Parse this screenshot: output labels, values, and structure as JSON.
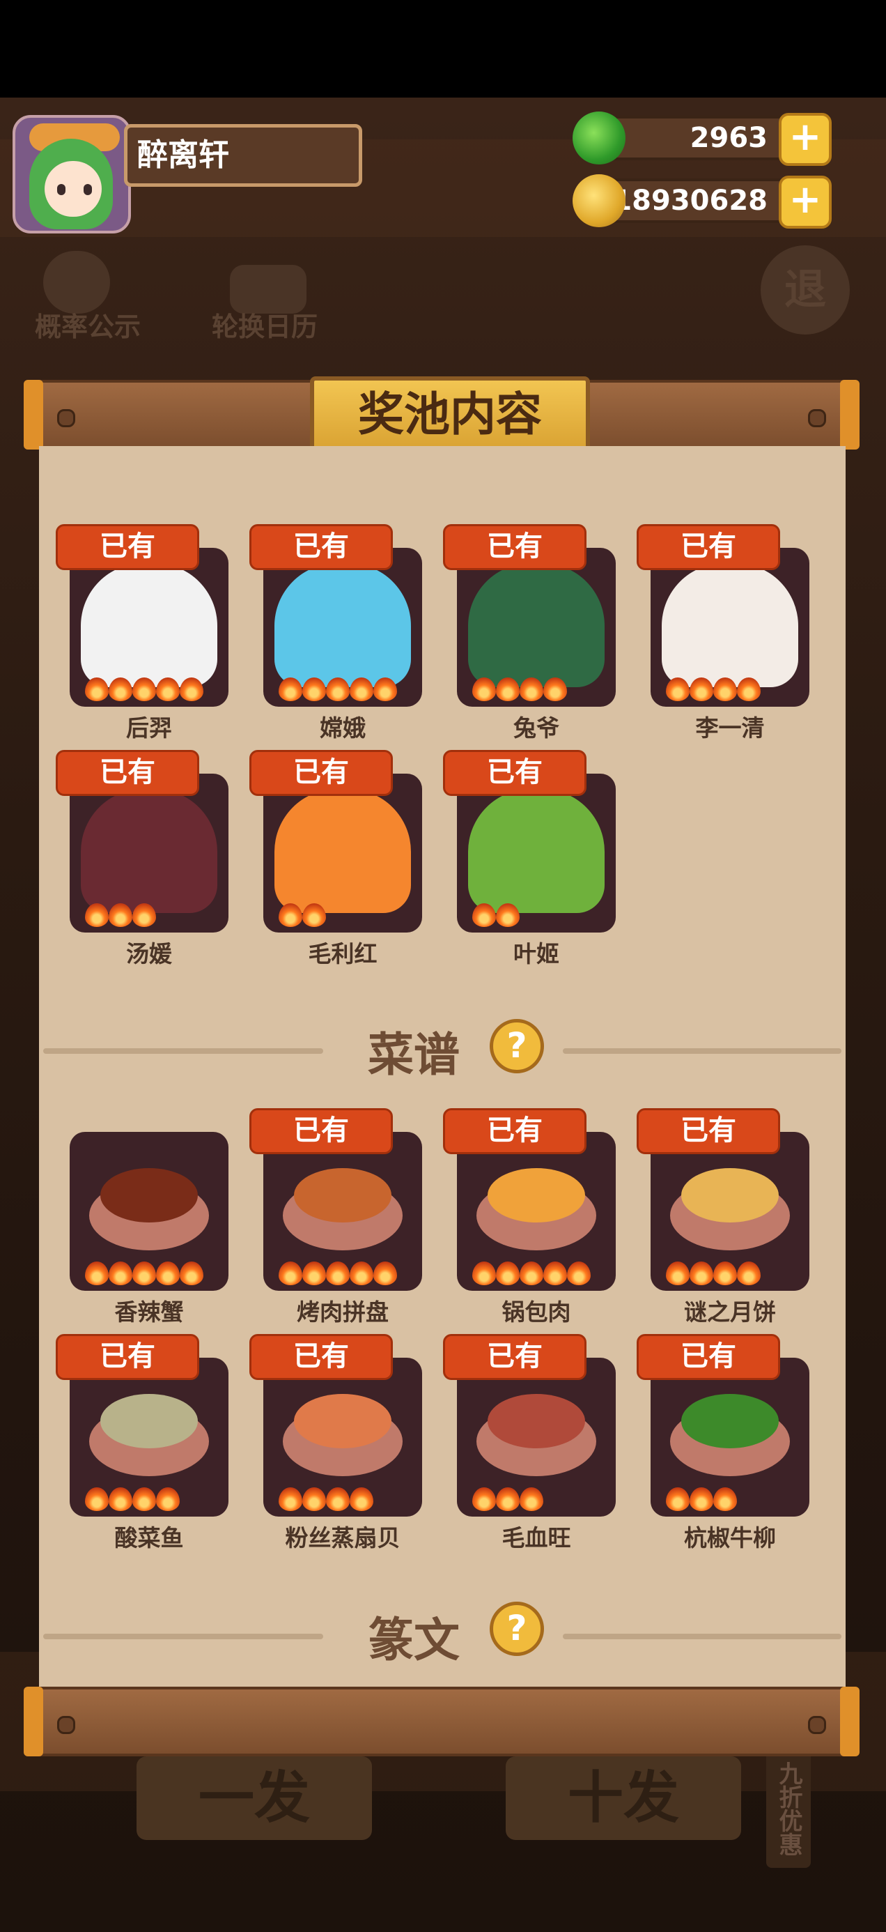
{
  "player": {
    "name": "醉离轩",
    "jade": "2963",
    "coins": "18930628"
  },
  "background_menu": {
    "probability": "概率公示",
    "rotation_calendar": "轮换日历",
    "exit": "退",
    "single_draw": "一发",
    "ten_draw": "十发",
    "discount": "九折优惠"
  },
  "panel": {
    "title": "奖池内容",
    "owned_label": "已有",
    "characters": [
      {
        "name": "后羿",
        "owned": true,
        "stars": 5,
        "color": "#f2f2f2"
      },
      {
        "name": "嫦娥",
        "owned": true,
        "stars": 5,
        "color": "#5cc6e8"
      },
      {
        "name": "兔爷",
        "owned": true,
        "stars": 4,
        "color": "#2f6a44"
      },
      {
        "name": "李一清",
        "owned": true,
        "stars": 4,
        "color": "#f3ece6"
      },
      {
        "name": "汤媛",
        "owned": true,
        "stars": 3,
        "color": "#6a2a32"
      },
      {
        "name": "毛利红",
        "owned": true,
        "stars": 2,
        "color": "#f5862e"
      },
      {
        "name": "叶姬",
        "owned": true,
        "stars": 2,
        "color": "#6fb13c"
      }
    ],
    "recipes_title": "菜谱",
    "recipes": [
      {
        "name": "香辣蟹",
        "owned": false,
        "stars": 5,
        "color": "#7a2c18"
      },
      {
        "name": "烤肉拼盘",
        "owned": true,
        "stars": 5,
        "color": "#c8652e"
      },
      {
        "name": "锅包肉",
        "owned": true,
        "stars": 5,
        "color": "#f0a23a"
      },
      {
        "name": "谜之月饼",
        "owned": true,
        "stars": 4,
        "color": "#e8b455"
      },
      {
        "name": "酸菜鱼",
        "owned": true,
        "stars": 4,
        "color": "#b8b28a"
      },
      {
        "name": "粉丝蒸扇贝",
        "owned": true,
        "stars": 4,
        "color": "#e07a4a"
      },
      {
        "name": "毛血旺",
        "owned": true,
        "stars": 3,
        "color": "#b04a3a"
      },
      {
        "name": "杭椒牛柳",
        "owned": true,
        "stars": 3,
        "color": "#3d8a2a"
      }
    ],
    "next_section_title": "篆文"
  }
}
